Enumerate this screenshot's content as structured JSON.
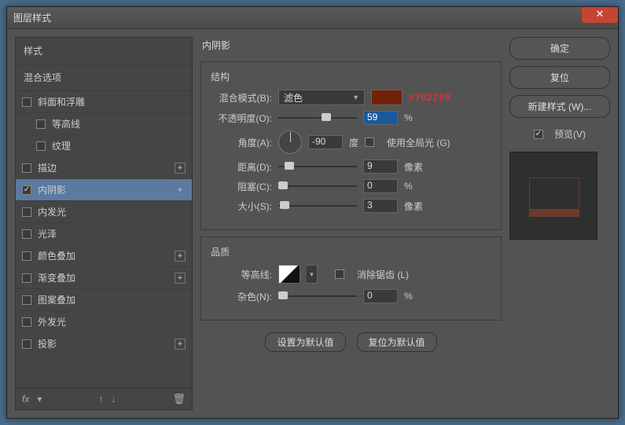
{
  "window": {
    "title": "图层样式"
  },
  "left": {
    "header_styles": "样式",
    "header_blend": "混合选项",
    "items": [
      {
        "label": "斜面和浮雕",
        "checked": false,
        "indent": false,
        "plus": false
      },
      {
        "label": "等高线",
        "checked": false,
        "indent": true,
        "plus": false
      },
      {
        "label": "纹理",
        "checked": false,
        "indent": true,
        "plus": false
      },
      {
        "label": "描边",
        "checked": false,
        "indent": false,
        "plus": true
      },
      {
        "label": "内阴影",
        "checked": true,
        "indent": false,
        "plus": true,
        "selected": true
      },
      {
        "label": "内发光",
        "checked": false,
        "indent": false,
        "plus": false
      },
      {
        "label": "光泽",
        "checked": false,
        "indent": false,
        "plus": false
      },
      {
        "label": "颜色叠加",
        "checked": false,
        "indent": false,
        "plus": true
      },
      {
        "label": "渐变叠加",
        "checked": false,
        "indent": false,
        "plus": true
      },
      {
        "label": "图案叠加",
        "checked": false,
        "indent": false,
        "plus": false
      },
      {
        "label": "外发光",
        "checked": false,
        "indent": false,
        "plus": false
      },
      {
        "label": "投影",
        "checked": false,
        "indent": false,
        "plus": true
      }
    ],
    "fx_label": "fx"
  },
  "panel": {
    "title": "内阴影",
    "structure": {
      "title": "结构",
      "blend_mode_label": "混合模式(B):",
      "blend_mode_value": "滤色",
      "color": "#702209",
      "color_annotation": "#702209",
      "opacity_label": "不透明度(O):",
      "opacity_value": "59",
      "opacity_unit": "%",
      "angle_label": "角度(A):",
      "angle_value": "-90",
      "angle_unit": "度",
      "global_light_label": "使用全局光 (G)",
      "global_light_checked": false,
      "distance_label": "距离(D):",
      "distance_value": "9",
      "distance_unit": "像素",
      "choke_label": "阻塞(C):",
      "choke_value": "0",
      "choke_unit": "%",
      "size_label": "大小(S):",
      "size_value": "3",
      "size_unit": "像素"
    },
    "quality": {
      "title": "品质",
      "contour_label": "等高线:",
      "anti_alias_label": "消除锯齿 (L)",
      "anti_alias_checked": false,
      "noise_label": "杂色(N):",
      "noise_value": "0",
      "noise_unit": "%"
    },
    "defaults_set": "设置为默认值",
    "defaults_reset": "复位为默认值"
  },
  "right": {
    "ok": "确定",
    "cancel": "复位",
    "new_style": "新建样式 (W)...",
    "preview_label": "预览(V)",
    "preview_checked": true
  }
}
